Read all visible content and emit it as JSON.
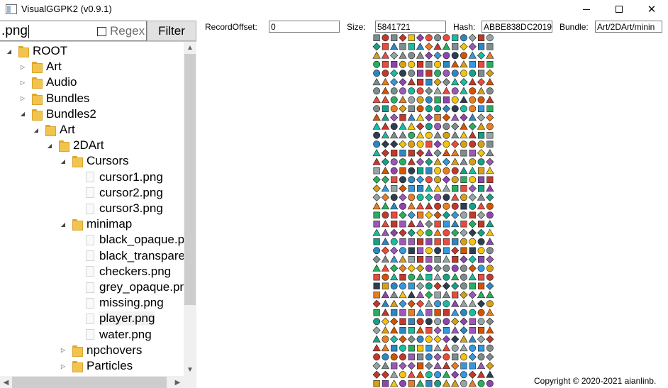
{
  "window": {
    "title": "VisualGGPK2 (v0.9.1)",
    "minimize": "",
    "maximize": "",
    "close": "✕"
  },
  "search": {
    "value": ".png",
    "regex_label": "Regex",
    "filter_label": "Filter"
  },
  "tree": [
    {
      "label": "ROOT",
      "type": "folder",
      "level": 0,
      "expander": "expanded"
    },
    {
      "label": "Art",
      "type": "folder",
      "level": 1,
      "expander": "collapsed"
    },
    {
      "label": "Audio",
      "type": "folder",
      "level": 1,
      "expander": "collapsed"
    },
    {
      "label": "Bundles",
      "type": "folder",
      "level": 1,
      "expander": "collapsed"
    },
    {
      "label": "Bundles2",
      "type": "folder",
      "level": 1,
      "expander": "expanded"
    },
    {
      "label": "Art",
      "type": "folder",
      "level": 2,
      "expander": "expanded"
    },
    {
      "label": "2DArt",
      "type": "folder",
      "level": 3,
      "expander": "expanded"
    },
    {
      "label": "Cursors",
      "type": "folder",
      "level": 4,
      "expander": "expanded"
    },
    {
      "label": "cursor1.png",
      "type": "file",
      "level": 5,
      "expander": "none"
    },
    {
      "label": "cursor2.png",
      "type": "file",
      "level": 5,
      "expander": "none"
    },
    {
      "label": "cursor3.png",
      "type": "file",
      "level": 5,
      "expander": "none"
    },
    {
      "label": "minimap",
      "type": "folder",
      "level": 4,
      "expander": "expanded"
    },
    {
      "label": "black_opaque.pr",
      "type": "file",
      "level": 5,
      "expander": "none"
    },
    {
      "label": "black_transparer",
      "type": "file",
      "level": 5,
      "expander": "none"
    },
    {
      "label": "checkers.png",
      "type": "file",
      "level": 5,
      "expander": "none"
    },
    {
      "label": "grey_opaque.pn",
      "type": "file",
      "level": 5,
      "expander": "none"
    },
    {
      "label": "missing.png",
      "type": "file",
      "level": 5,
      "expander": "none"
    },
    {
      "label": "player.png",
      "type": "file",
      "level": 5,
      "expander": "none",
      "selected": true
    },
    {
      "label": "water.png",
      "type": "file",
      "level": 5,
      "expander": "none"
    },
    {
      "label": "npchovers",
      "type": "folder",
      "level": 4,
      "expander": "collapsed"
    },
    {
      "label": "Particles",
      "type": "folder",
      "level": 4,
      "expander": "collapsed"
    }
  ],
  "scroll_arrows": {
    "up": "▲",
    "down": "▼",
    "left": "◀",
    "right": "▶"
  },
  "record": {
    "offset_label": "RecordOffset:",
    "offset_value": "0",
    "size_label": "Size:",
    "size_value": "5841721",
    "hash_label": "Hash:",
    "hash_value": "ABBE838DC2019",
    "bundle_label": "Bundle:",
    "bundle_value": "Art/2DArt/minin"
  },
  "preview": {
    "description_icon": "sprite-sheet-image",
    "columns": 14,
    "rows": 40,
    "palette": [
      "#d4a017",
      "#c0392b",
      "#2e86c1",
      "#27ae60",
      "#8e44ad",
      "#e67e22",
      "#16a085",
      "#7f8c8d",
      "#1abc9c",
      "#f1c40f",
      "#e74c3c",
      "#3498db",
      "#9b59b6",
      "#2c3e50",
      "#d35400",
      "#95a5a6"
    ]
  },
  "footer": {
    "copyright": "Copyright © 2020-2021 aianlinb."
  },
  "colors": {
    "folder": "#f2c44e",
    "scrollbar_track": "#f0f0f0",
    "scrollbar_thumb": "#cdcdcd",
    "filter_button_bg": "#e1e1e1"
  }
}
